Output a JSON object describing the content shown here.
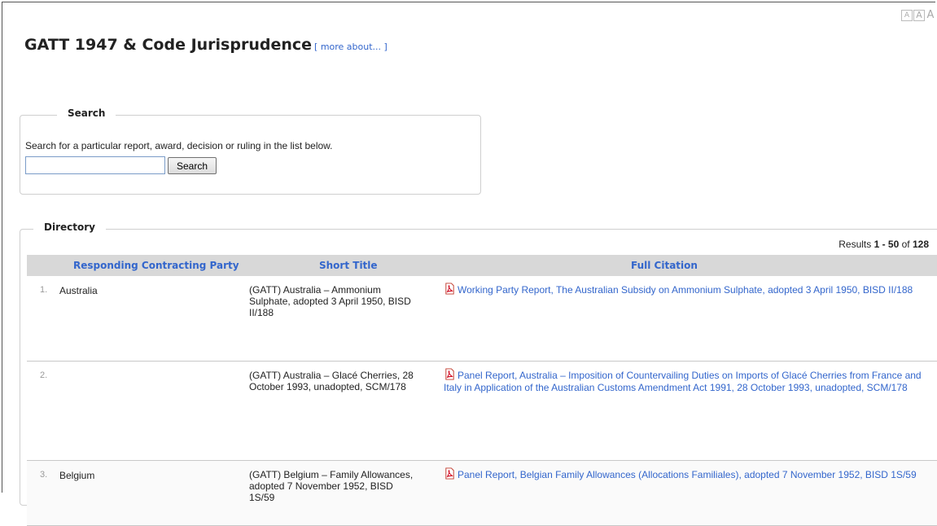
{
  "font_controls": [
    "A",
    "A",
    "A"
  ],
  "header": {
    "title": "GATT 1947 & Code Jurisprudence",
    "more_link": "[ more about... ]"
  },
  "search": {
    "legend": "Search",
    "description": "Search for a particular report, award, decision or ruling in the list below.",
    "input_value": "",
    "button_label": "Search"
  },
  "directory": {
    "legend": "Directory",
    "results_prefix": "Results ",
    "results_range": "1 - 50",
    "results_of": " of ",
    "results_total": "128",
    "columns": [
      "Responding Contracting Party",
      "Short Title",
      "Full Citation"
    ],
    "rows": [
      {
        "num": "1.",
        "party": "Australia",
        "short_title": "(GATT) Australia – Ammonium Sulphate, adopted 3 April 1950, BISD II/188",
        "full_citation": "Working Party Report, The Australian Subsidy on Ammonium Sulphate, adopted 3 April 1950, BISD II/188"
      },
      {
        "num": "2.",
        "party": "",
        "short_title": "(GATT) Australia – Glacé Cherries, 28 October 1993, unadopted, SCM/178",
        "full_citation": "Panel Report, Australia – Imposition of Countervailing Duties on Imports of Glacé Cherries from France and Italy in Application of the Australian Customs Amendment Act 1991, 28 October 1993, unadopted, SCM/178"
      },
      {
        "num": "3.",
        "party": "Belgium",
        "short_title": "(GATT) Belgium – Family Allowances, adopted 7 November 1952, BISD 1S/59",
        "full_citation": "Panel Report, Belgian Family Allowances (Allocations Familiales), adopted 7 November 1952, BISD 1S/59"
      }
    ]
  },
  "icons": {
    "pdf": "pdf-icon"
  },
  "colors": {
    "link": "#3366cc",
    "header_bg": "#d8d8d8"
  }
}
